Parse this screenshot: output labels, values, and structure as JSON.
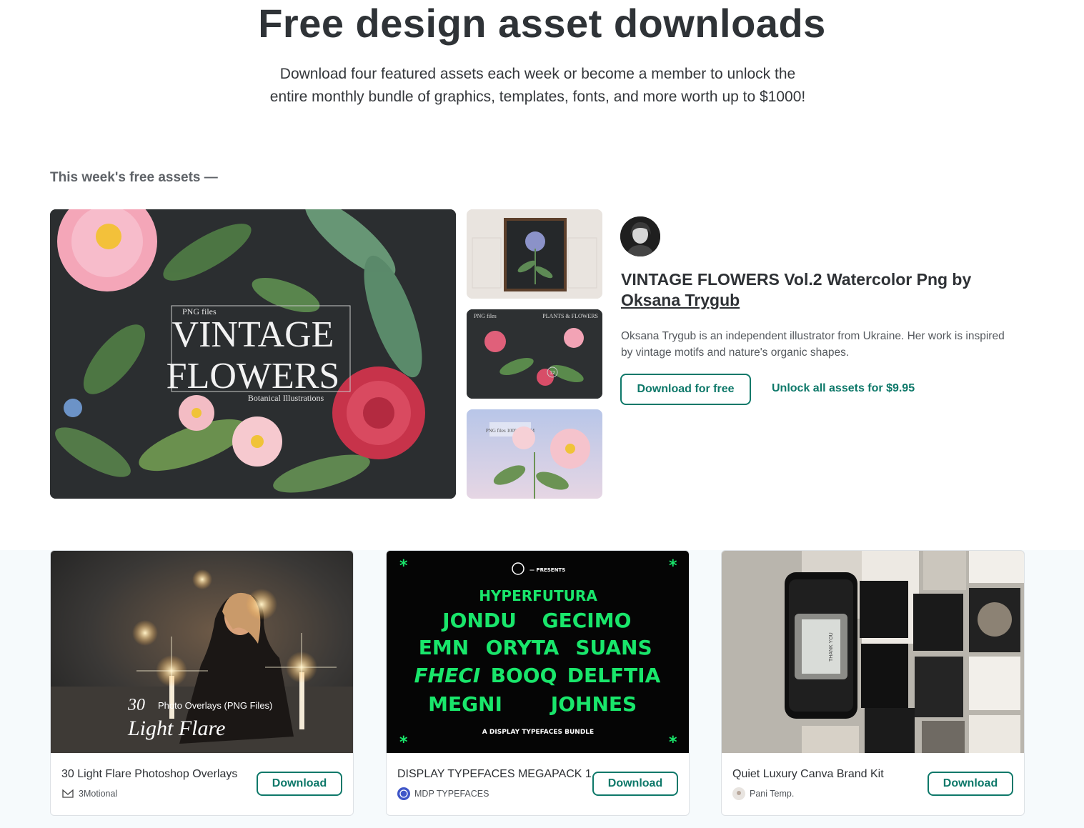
{
  "hero": {
    "title": "Free design asset downloads",
    "subtitle_line1": "Download four featured assets each week or become a member to unlock the",
    "subtitle_line2": "entire monthly bundle of graphics, templates, fonts, and more worth up to $1000!"
  },
  "featured": {
    "section_label": "This week's free assets —",
    "main_image": {
      "small_text": "PNG files",
      "line1": "VINTAGE",
      "line2": "FLOWERS",
      "caption": "Botanical Illustrations"
    },
    "thumb2": {
      "left": "PNG files",
      "right": "PLANTS & FLOWERS",
      "badge": "12"
    },
    "thumb3": {
      "label": "PNG files 100% ZOOM"
    },
    "title": "VINTAGE FLOWERS Vol.2 Watercolor Png by",
    "author_link": "Oksana Trygub",
    "description": "Oksana Trygub is an independent illustrator from Ukraine. Her work is inspired by vintage motifs and nature's organic shapes.",
    "download_label": "Download for free",
    "unlock_label": "Unlock all assets for $9.95"
  },
  "cards": [
    {
      "title": "30 Light Flare Photoshop Overlays",
      "author": "3Motional",
      "button": "Download",
      "overlay_count": "30",
      "overlay_text": "Photo Overlays (PNG Files)",
      "overlay_script": "Light Flare"
    },
    {
      "title": "DISPLAY TYPEFACES MEGAPACK 1",
      "author": "MDP TYPEFACES",
      "button": "Download",
      "presents": "— PRESENTS",
      "fonts": [
        "HYPERFUTURA",
        "JONDU",
        "GECIMO",
        "EMN",
        "ORYTA",
        "SUANS",
        "FHECI",
        "BOOQ",
        "DELFTIA",
        "MEGNI",
        "JOHNES"
      ],
      "bundle": "A DISPLAY TYPEFACES BUNDLE"
    },
    {
      "title": "Quiet Luxury Canva Brand Kit",
      "author": "Pani Temp.",
      "button": "Download",
      "phone_text": "THANK YOU"
    }
  ],
  "colors": {
    "accent": "#0d7869",
    "text": "#2e3135",
    "neon": "#19e66b"
  }
}
